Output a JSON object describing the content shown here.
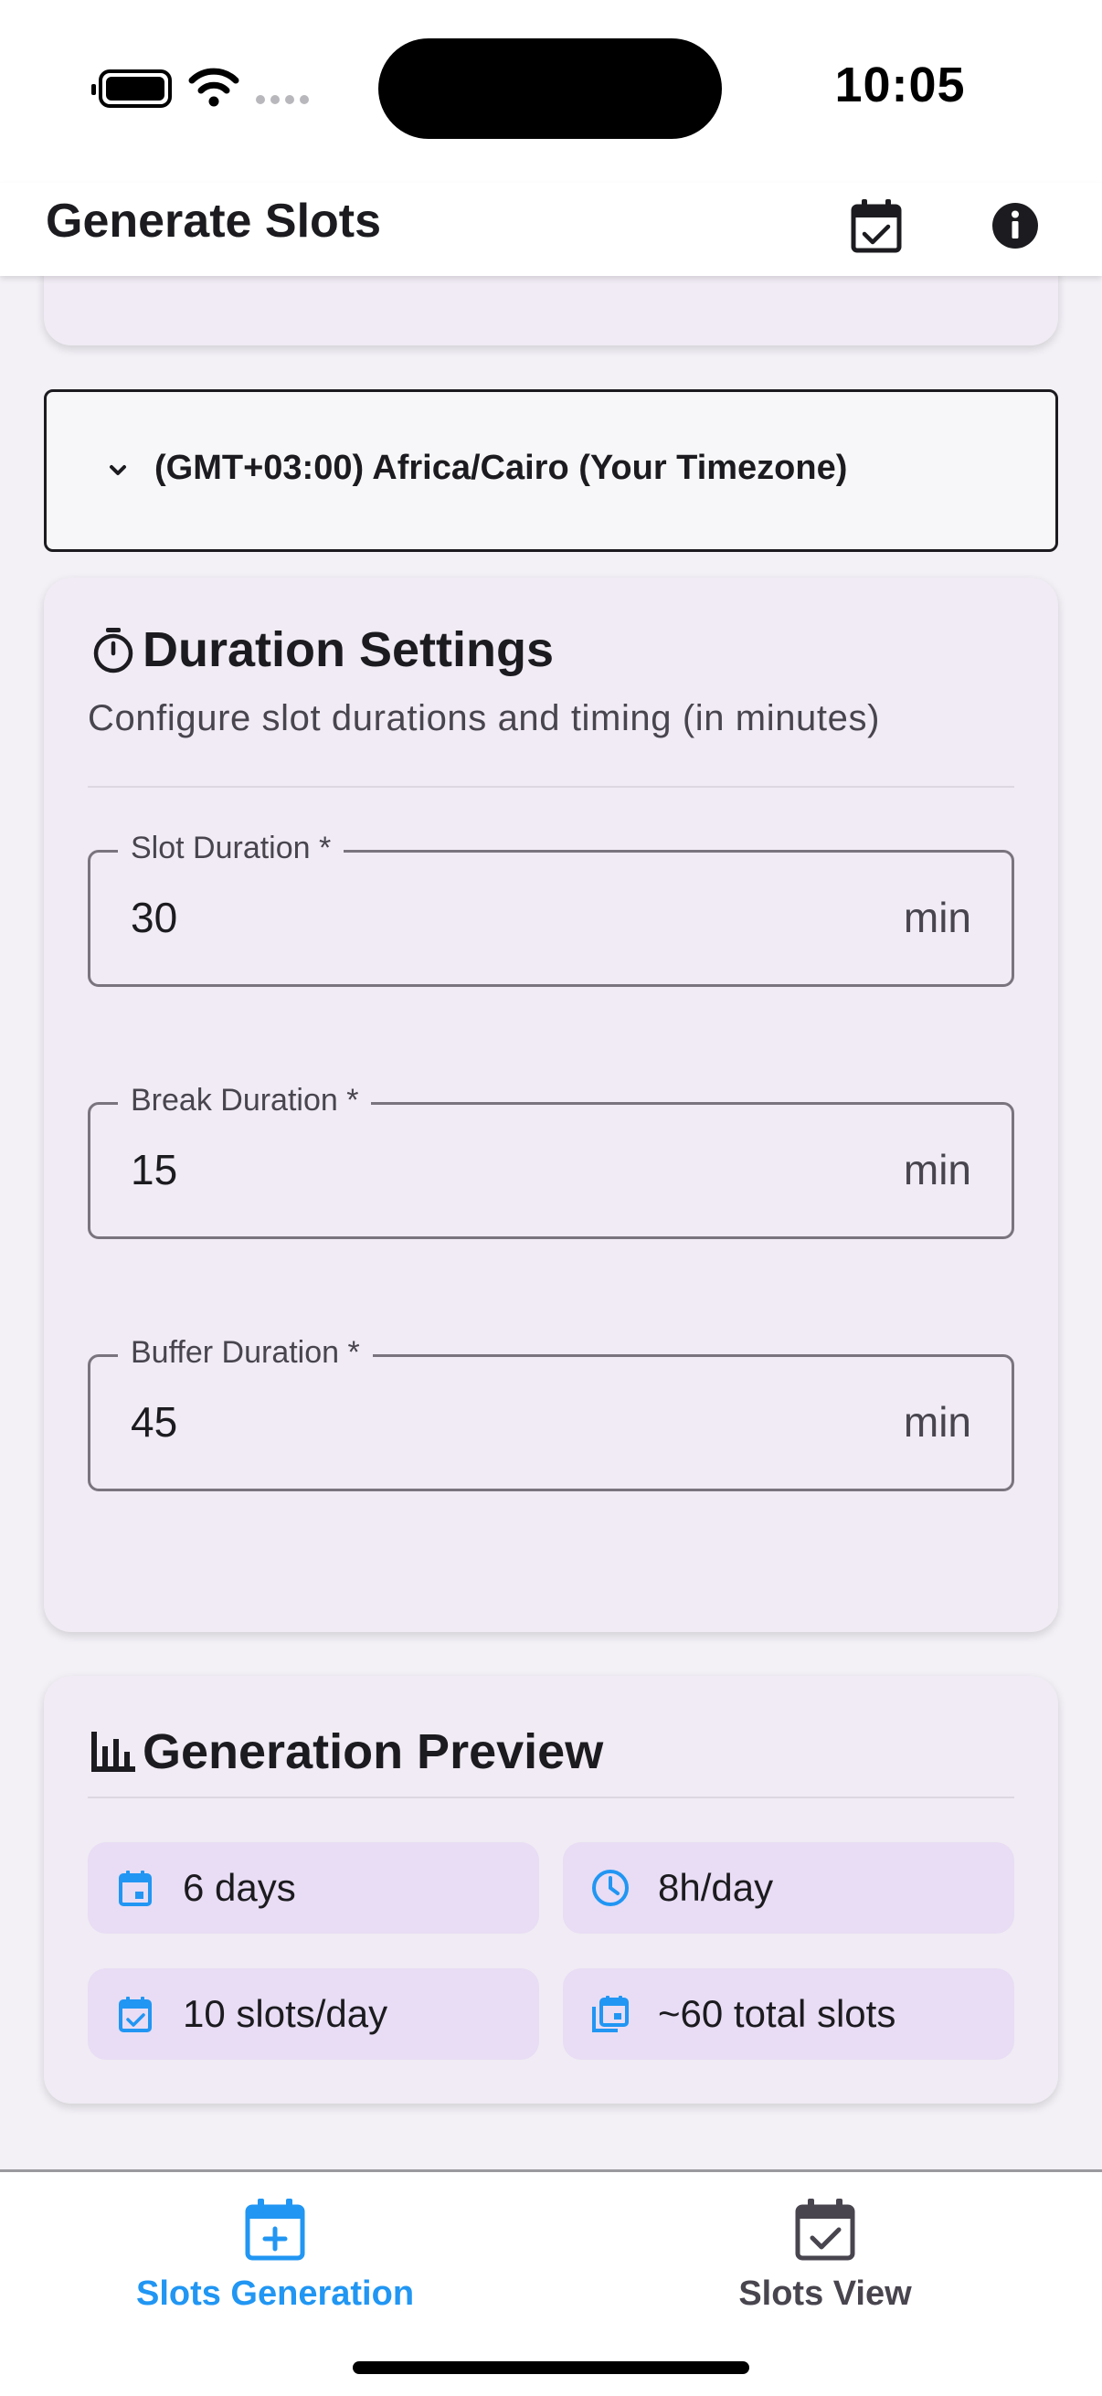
{
  "status_bar": {
    "time": "10:05"
  },
  "app_bar": {
    "title": "Generate Slots",
    "icons": [
      "calendar-check-icon",
      "info-icon"
    ]
  },
  "timezone": {
    "label": "(GMT+03:00) Africa/Cairo (Your Timezone)"
  },
  "duration_settings": {
    "title": "Duration Settings",
    "subtitle": "Configure slot durations and timing (in minutes)",
    "fields": [
      {
        "label": "Slot Duration *",
        "value": "30",
        "suffix": "min"
      },
      {
        "label": "Break Duration *",
        "value": "15",
        "suffix": "min"
      },
      {
        "label": "Buffer Duration *",
        "value": "45",
        "suffix": "min"
      }
    ]
  },
  "generation_preview": {
    "title": "Generation Preview",
    "stats": [
      {
        "icon": "calendar-icon",
        "text": "6 days"
      },
      {
        "icon": "clock-icon",
        "text": "8h/day"
      },
      {
        "icon": "calendar-check-icon",
        "text": "10 slots/day"
      },
      {
        "icon": "calendar-multiple-icon",
        "text": "~60 total slots"
      }
    ]
  },
  "bottom_nav": {
    "items": [
      {
        "label": "Slots Generation",
        "icon": "calendar-plus-icon",
        "active": true
      },
      {
        "label": "Slots View",
        "icon": "calendar-check-icon",
        "active": false
      }
    ]
  },
  "colors": {
    "accent": "#2196f3",
    "card": "#f0ebf4",
    "tile": "#e8ddf4",
    "text": "#1c1b1f"
  }
}
